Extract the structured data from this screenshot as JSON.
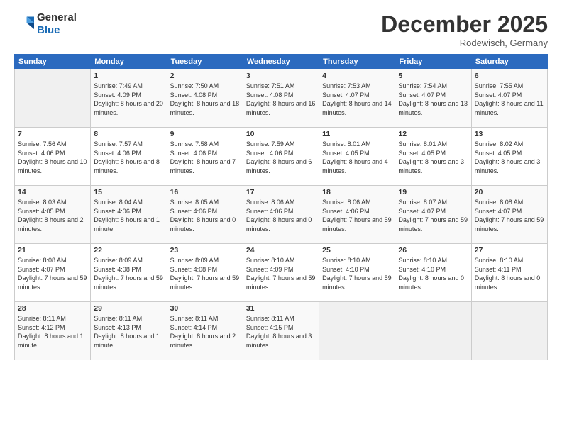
{
  "header": {
    "logo_line1": "General",
    "logo_line2": "Blue",
    "month": "December 2025",
    "location": "Rodewisch, Germany"
  },
  "weekdays": [
    "Sunday",
    "Monday",
    "Tuesday",
    "Wednesday",
    "Thursday",
    "Friday",
    "Saturday"
  ],
  "weeks": [
    [
      {
        "num": "",
        "empty": true
      },
      {
        "num": "1",
        "sunrise": "7:49 AM",
        "sunset": "4:09 PM",
        "daylight": "8 hours and 20 minutes."
      },
      {
        "num": "2",
        "sunrise": "7:50 AM",
        "sunset": "4:08 PM",
        "daylight": "8 hours and 18 minutes."
      },
      {
        "num": "3",
        "sunrise": "7:51 AM",
        "sunset": "4:08 PM",
        "daylight": "8 hours and 16 minutes."
      },
      {
        "num": "4",
        "sunrise": "7:53 AM",
        "sunset": "4:07 PM",
        "daylight": "8 hours and 14 minutes."
      },
      {
        "num": "5",
        "sunrise": "7:54 AM",
        "sunset": "4:07 PM",
        "daylight": "8 hours and 13 minutes."
      },
      {
        "num": "6",
        "sunrise": "7:55 AM",
        "sunset": "4:07 PM",
        "daylight": "8 hours and 11 minutes."
      }
    ],
    [
      {
        "num": "7",
        "sunrise": "7:56 AM",
        "sunset": "4:06 PM",
        "daylight": "8 hours and 10 minutes."
      },
      {
        "num": "8",
        "sunrise": "7:57 AM",
        "sunset": "4:06 PM",
        "daylight": "8 hours and 8 minutes."
      },
      {
        "num": "9",
        "sunrise": "7:58 AM",
        "sunset": "4:06 PM",
        "daylight": "8 hours and 7 minutes."
      },
      {
        "num": "10",
        "sunrise": "7:59 AM",
        "sunset": "4:06 PM",
        "daylight": "8 hours and 6 minutes."
      },
      {
        "num": "11",
        "sunrise": "8:01 AM",
        "sunset": "4:05 PM",
        "daylight": "8 hours and 4 minutes."
      },
      {
        "num": "12",
        "sunrise": "8:01 AM",
        "sunset": "4:05 PM",
        "daylight": "8 hours and 3 minutes."
      },
      {
        "num": "13",
        "sunrise": "8:02 AM",
        "sunset": "4:05 PM",
        "daylight": "8 hours and 3 minutes."
      }
    ],
    [
      {
        "num": "14",
        "sunrise": "8:03 AM",
        "sunset": "4:05 PM",
        "daylight": "8 hours and 2 minutes."
      },
      {
        "num": "15",
        "sunrise": "8:04 AM",
        "sunset": "4:06 PM",
        "daylight": "8 hours and 1 minute."
      },
      {
        "num": "16",
        "sunrise": "8:05 AM",
        "sunset": "4:06 PM",
        "daylight": "8 hours and 0 minutes."
      },
      {
        "num": "17",
        "sunrise": "8:06 AM",
        "sunset": "4:06 PM",
        "daylight": "8 hours and 0 minutes."
      },
      {
        "num": "18",
        "sunrise": "8:06 AM",
        "sunset": "4:06 PM",
        "daylight": "7 hours and 59 minutes."
      },
      {
        "num": "19",
        "sunrise": "8:07 AM",
        "sunset": "4:07 PM",
        "daylight": "7 hours and 59 minutes."
      },
      {
        "num": "20",
        "sunrise": "8:08 AM",
        "sunset": "4:07 PM",
        "daylight": "7 hours and 59 minutes."
      }
    ],
    [
      {
        "num": "21",
        "sunrise": "8:08 AM",
        "sunset": "4:07 PM",
        "daylight": "7 hours and 59 minutes."
      },
      {
        "num": "22",
        "sunrise": "8:09 AM",
        "sunset": "4:08 PM",
        "daylight": "7 hours and 59 minutes."
      },
      {
        "num": "23",
        "sunrise": "8:09 AM",
        "sunset": "4:08 PM",
        "daylight": "7 hours and 59 minutes."
      },
      {
        "num": "24",
        "sunrise": "8:10 AM",
        "sunset": "4:09 PM",
        "daylight": "7 hours and 59 minutes."
      },
      {
        "num": "25",
        "sunrise": "8:10 AM",
        "sunset": "4:10 PM",
        "daylight": "7 hours and 59 minutes."
      },
      {
        "num": "26",
        "sunrise": "8:10 AM",
        "sunset": "4:10 PM",
        "daylight": "8 hours and 0 minutes."
      },
      {
        "num": "27",
        "sunrise": "8:10 AM",
        "sunset": "4:11 PM",
        "daylight": "8 hours and 0 minutes."
      }
    ],
    [
      {
        "num": "28",
        "sunrise": "8:11 AM",
        "sunset": "4:12 PM",
        "daylight": "8 hours and 1 minute."
      },
      {
        "num": "29",
        "sunrise": "8:11 AM",
        "sunset": "4:13 PM",
        "daylight": "8 hours and 1 minute."
      },
      {
        "num": "30",
        "sunrise": "8:11 AM",
        "sunset": "4:14 PM",
        "daylight": "8 hours and 2 minutes."
      },
      {
        "num": "31",
        "sunrise": "8:11 AM",
        "sunset": "4:15 PM",
        "daylight": "8 hours and 3 minutes."
      },
      {
        "num": "",
        "empty": true
      },
      {
        "num": "",
        "empty": true
      },
      {
        "num": "",
        "empty": true
      }
    ]
  ]
}
